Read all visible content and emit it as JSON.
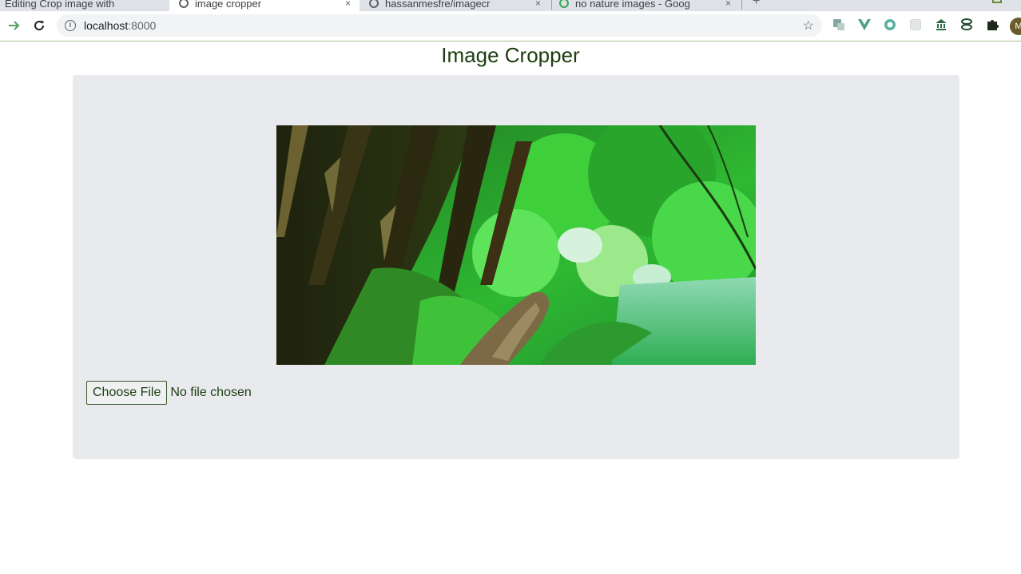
{
  "browser": {
    "tabs": [
      {
        "title": "Editing Crop image with",
        "active": false
      },
      {
        "title": "image cropper",
        "active": true
      },
      {
        "title": "hassanmesfre/imagecr",
        "active": false
      },
      {
        "title": "no nature images - Goog",
        "active": false
      }
    ],
    "new_tab_symbol": "+",
    "close_symbol": "×",
    "address": {
      "host": "localhost",
      "port": ":8000"
    },
    "icons": {
      "back": "back-arrow-icon",
      "reload": "reload-icon",
      "info": "site-info-icon",
      "bookmark": "star-icon",
      "extensions": [
        "translate-icon",
        "vue-devtools-icon",
        "circle-extension-icon",
        "grid-extension-icon",
        "bank-icon",
        "stack-extension-icon",
        "puzzle-icon"
      ]
    },
    "avatar_initial": "M"
  },
  "page": {
    "title": "Image Cropper",
    "file_input": {
      "button_label": "Choose File",
      "status": "No file chosen"
    }
  },
  "colors": {
    "text": "#1c3d0f",
    "card_background": "#e9eaee",
    "page_background": "#ffffff"
  }
}
